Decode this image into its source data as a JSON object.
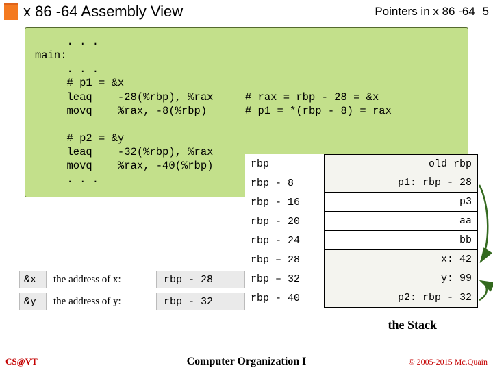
{
  "header": {
    "title": "x 86 -64 Assembly View",
    "topic": "Pointers in x 86 -64",
    "page": "5"
  },
  "code_block": "     . . .\nmain:\n     . . .\n     # p1 = &x\n     leaq    -28(%rbp), %rax     # rax = rbp - 28 = &x\n     movq    %rax, -8(%rbp)      # p1 = *(rbp - 8) = rax\n\n     # p2 = &y\n     leaq    -32(%rbp), %rax\n     movq    %rax, -40(%rbp)\n     . . .",
  "memory": {
    "rows": [
      {
        "addr": "rbp",
        "val": "old rbp"
      },
      {
        "addr": "rbp -  8",
        "val": "p1: rbp - 28"
      },
      {
        "addr": "rbp - 16",
        "val": "p3"
      },
      {
        "addr": "rbp - 20",
        "val": "aa"
      },
      {
        "addr": "rbp - 24",
        "val": "bb"
      },
      {
        "addr": "rbp – 28",
        "val": "x:  42"
      },
      {
        "addr": "rbp – 32",
        "val": "y:  99"
      },
      {
        "addr": "rbp - 40",
        "val": "p2: rbp - 32"
      }
    ]
  },
  "addr_table": {
    "rows": [
      {
        "sym": "&x",
        "desc": "the address of x:",
        "expr": "rbp - 28"
      },
      {
        "sym": "&y",
        "desc": "the address of y:",
        "expr": "rbp - 32"
      }
    ]
  },
  "stack_label": "the Stack",
  "footer": {
    "left": "CS@VT",
    "mid": "Computer Organization I",
    "right": "© 2005-2015 Mc.Quain"
  }
}
